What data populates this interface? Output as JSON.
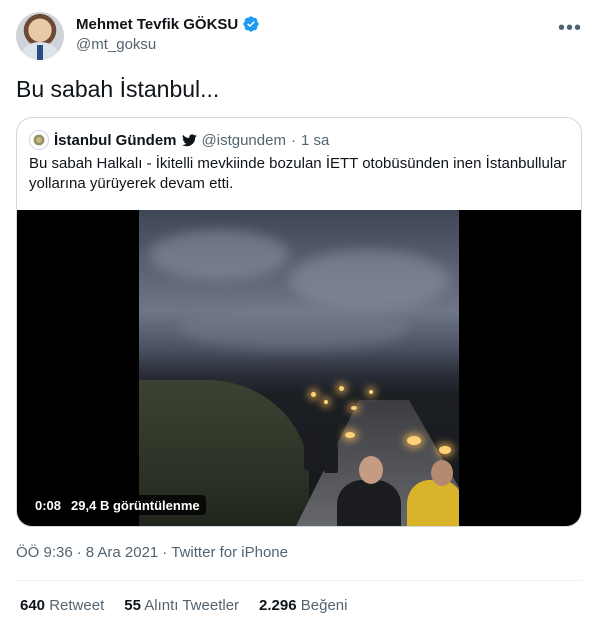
{
  "author": {
    "name": "Mehmet Tevfik GÖKSU",
    "handle": "@mt_goksu"
  },
  "more_icon": "•••",
  "tweet_text": "Bu sabah İstanbul...",
  "quote": {
    "name": "İstanbul Gündem",
    "handle": "@istgundem",
    "separator": "·",
    "time": "1 sa",
    "text": "Bu sabah Halkalı - İkitelli mevkiinde bozulan İETT otobüsünden inen İstanbullular yollarına yürüyerek devam etti.",
    "video": {
      "duration": "0:08",
      "views": "29,4 B görüntülenme"
    }
  },
  "meta": {
    "time": "ÖÖ 9:36",
    "separator1": "·",
    "date": "8 Ara 2021",
    "separator2": "·",
    "source": "Twitter for iPhone"
  },
  "stats": [
    {
      "count": "640",
      "label": "Retweet"
    },
    {
      "count": "55",
      "label": "Alıntı Tweetler"
    },
    {
      "count": "2.296",
      "label": "Beğeni"
    }
  ],
  "colors": {
    "text": "#0f1419",
    "secondary": "#536471",
    "verified": "#1d9bf0",
    "border": "#cfd9de"
  }
}
